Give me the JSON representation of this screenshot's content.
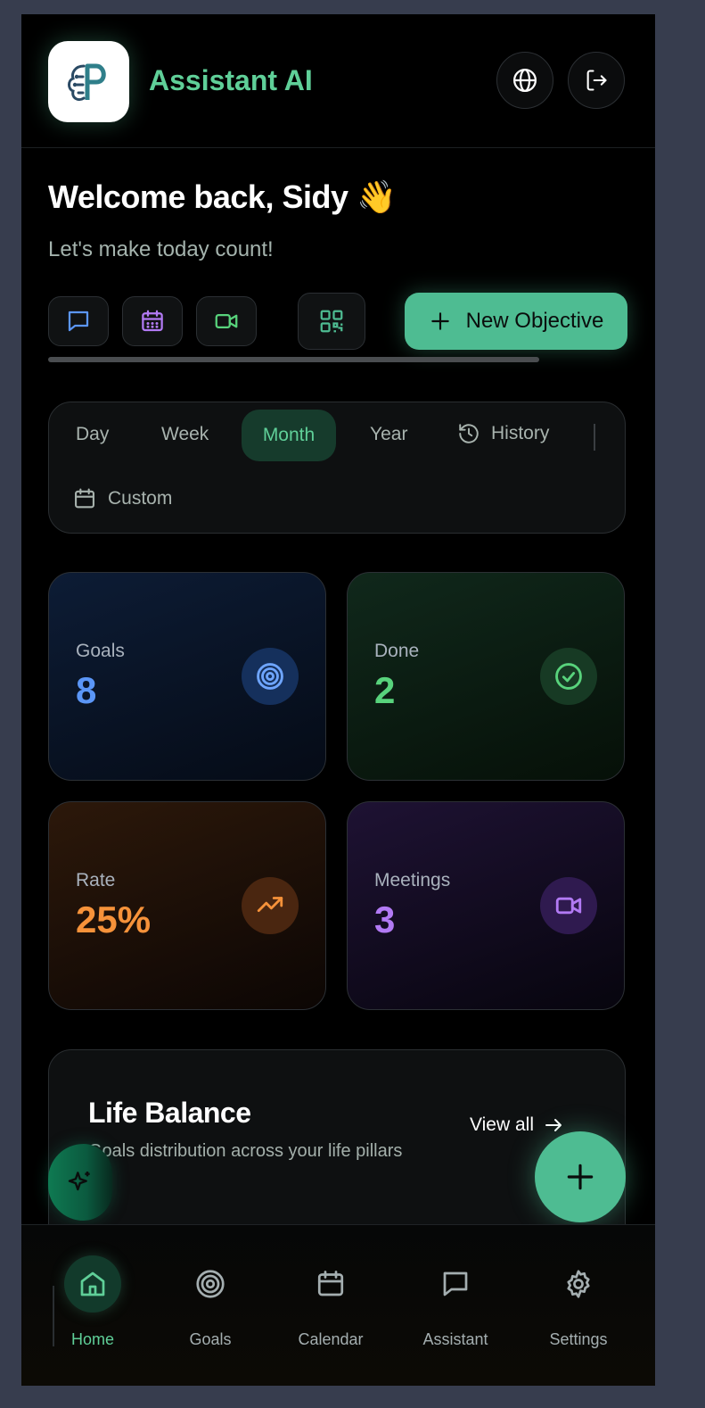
{
  "header": {
    "app_title": "Assistant AI",
    "logo_icon": "brain-p-logo-icon",
    "actions": [
      {
        "name": "language",
        "icon": "globe-icon"
      },
      {
        "name": "logout",
        "icon": "logout-icon"
      }
    ]
  },
  "welcome": {
    "title": "Welcome back, Sidy 👋",
    "subtitle": "Let's make today count!"
  },
  "quick_actions": {
    "chat_icon": "chat-icon",
    "calendar_icon": "calendar-icon",
    "video_icon": "video-icon",
    "qr_icon": "qr-code-icon",
    "new_objective_label": "New Objective"
  },
  "periods": {
    "day": "Day",
    "week": "Week",
    "month": "Month",
    "year": "Year",
    "history": "History",
    "custom": "Custom",
    "selected": "Month"
  },
  "stats": {
    "goals": {
      "label": "Goals",
      "value": "8",
      "icon": "target-icon",
      "color": "#5b96f7"
    },
    "done": {
      "label": "Done",
      "value": "2",
      "icon": "check-circle-icon",
      "color": "#58d37c"
    },
    "rate": {
      "label": "Rate",
      "value": "25%",
      "icon": "trending-up-icon",
      "color": "#f6923a"
    },
    "meetings": {
      "label": "Meetings",
      "value": "3",
      "icon": "video-icon",
      "color": "#b27af4"
    }
  },
  "life_balance": {
    "title": "Life Balance",
    "subtitle": "Goals distribution across your life pillars",
    "view_all": "View all"
  },
  "nav": {
    "home": "Home",
    "goals": "Goals",
    "calendar": "Calendar",
    "assistant": "Assistant",
    "settings": "Settings",
    "active": "Home"
  },
  "colors": {
    "accent": "#4ebc92",
    "accent_text": "#5fcf98",
    "background": "#000000"
  }
}
